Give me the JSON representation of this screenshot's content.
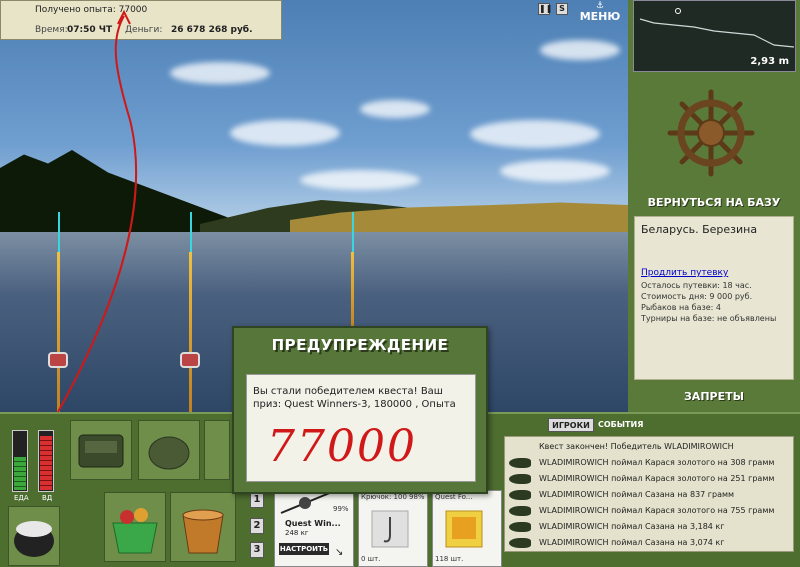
{
  "info": {
    "experience_label": "Получено опыта:",
    "experience_value": "77000",
    "time_label": "Время:",
    "time_value": "07:50 ЧТ",
    "money_label": "Деньги:",
    "money_value": "26 678 268 руб."
  },
  "top": {
    "pause_icon": "pause-icon",
    "sound_label": "S",
    "menu_label": "МЕНЮ"
  },
  "depth": {
    "value": "2,93 m"
  },
  "right_panel": {
    "return_label": "ВЕРНУТЬСЯ НА БАЗУ",
    "location": "Беларусь. Березина",
    "extend_link": "Продлить путевку",
    "trip_left": "Осталось путевки: 18 час.",
    "day_cost": "Стоимость дня: 9 000 руб.",
    "anglers": "Рыбаков на базе: 4",
    "tournaments": "Турниры на базе: не объявлены",
    "bans_label": "ЗАПРЕТЫ"
  },
  "bars": {
    "food_label": "ЕДА",
    "food_level": 0.55,
    "vd_label": "ВД",
    "vd_level": 0.9
  },
  "slots": {
    "buttons": [
      "1",
      "2",
      "3"
    ]
  },
  "tackle": {
    "name": "Quest Win...",
    "weight": "248 кг",
    "percent": "99%",
    "setup_label": "НАСТРОИТЬ"
  },
  "items": [
    {
      "title": "Крючок: 100",
      "stat": "98%",
      "count": "0 шт."
    },
    {
      "title": "Quest Fo...",
      "stat": "",
      "count": "118 шт."
    }
  ],
  "tabs": {
    "players": "ИГРОКИ",
    "events": "СОБЫТИЯ"
  },
  "events": [
    "Квест закончен! Победитель WLADIMIROWICH",
    "WLADIMIROWICH поймал Карася золотого на 308 грамм",
    "WLADIMIROWICH поймал Карася золотого на 251 грамм",
    "WLADIMIROWICH поймал Сазана на 837 грамм",
    "WLADIMIROWICH поймал Карася золотого на 755 грамм",
    "WLADIMIROWICH поймал Сазана на 3,184 кг",
    "WLADIMIROWICH поймал Сазана на 3,074 кг"
  ],
  "warning": {
    "title": "ПРЕДУПРЕЖДЕНИЕ",
    "message": "Вы стали победителем квеста! Ваш приз: Quest Winners-3, 180000 , Опыта",
    "handwritten": "77000"
  },
  "colors": {
    "panel_green": "#5a7a3a",
    "annotation_red": "#d01818",
    "link_blue": "#0000cc"
  }
}
